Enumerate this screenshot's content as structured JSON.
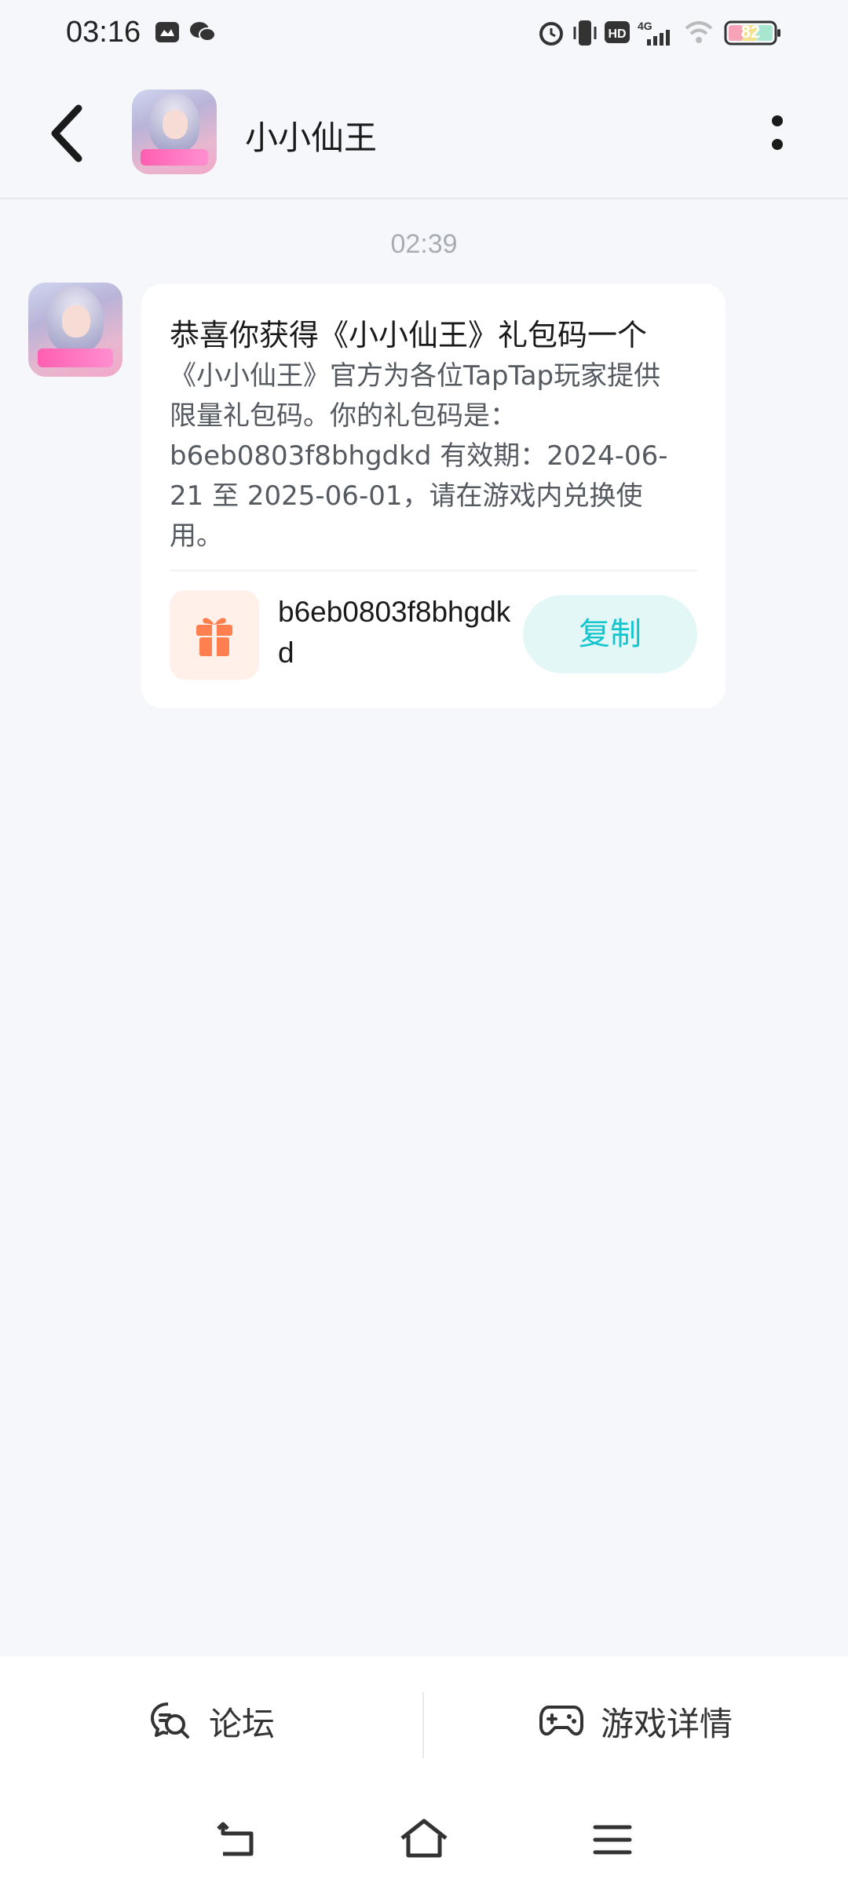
{
  "status_bar": {
    "time": "03:16",
    "icons": [
      "message-icon",
      "wechat-icon",
      "alarm-icon",
      "vibrate-icon",
      "hd-icon",
      "signal-4g-icon",
      "wifi-icon",
      "battery-icon"
    ],
    "network": "4G",
    "battery": "82"
  },
  "header": {
    "title": "小小仙王",
    "icons": [
      "back-icon",
      "more-icon"
    ]
  },
  "chat": {
    "timestamp": "02:39",
    "message": {
      "title": "恭喜你获得《小小仙王》礼包码一个",
      "body": "《小小仙王》官方为各位TapTap玩家提供限量礼包码。你的礼包码是：b6eb0803f8bhgdkd 有效期：2024-06-21 至 2025-06-01，请在游戏内兑换使用。",
      "code": "b6eb0803f8bhgdkd",
      "copy_label": "复制"
    }
  },
  "bottom_bar": {
    "forum_label": "论坛",
    "game_detail_label": "游戏详情"
  },
  "nav_bar": {
    "icons": [
      "back-nav-icon",
      "home-icon",
      "menu-icon"
    ]
  },
  "colors": {
    "accent": "#15c5ce",
    "copy_bg": "#e3f8f6",
    "gift": "#ff7f50",
    "gift_bg": "#fff0ea",
    "background": "#f5f7fa"
  }
}
